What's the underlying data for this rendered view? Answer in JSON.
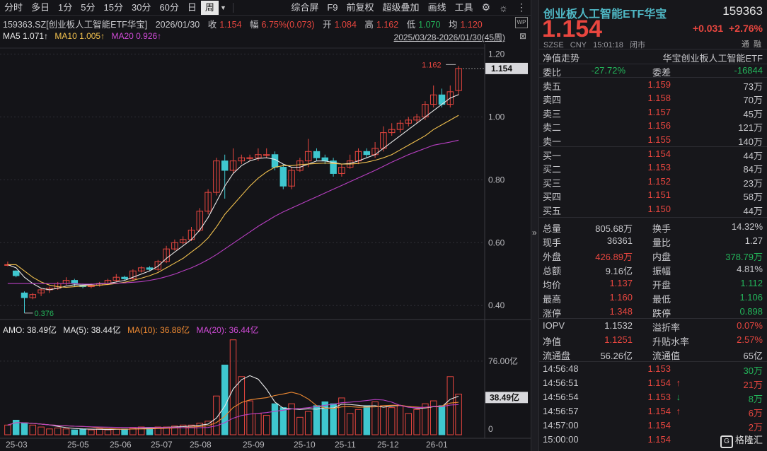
{
  "toolbar": {
    "periods": [
      "分时",
      "多日",
      "1分",
      "5分",
      "15分",
      "30分",
      "60分",
      "日",
      "周"
    ],
    "active_index": 8,
    "dropdown_icon": "caret-down-icon",
    "tools": [
      "综合屏",
      "F9",
      "前复权",
      "超级叠加",
      "画线",
      "工具"
    ],
    "icons": [
      "gear-icon",
      "sun-icon",
      "more-icon"
    ]
  },
  "info": {
    "symbol": "159363.SZ[创业板人工智能ETF华宝]",
    "date": "2026/01/30",
    "close_label": "收",
    "close": "1.154",
    "amp_label": "幅",
    "amp": "6.75%(0.073)",
    "open_label": "开",
    "open": "1.084",
    "high_label": "高",
    "high": "1.162",
    "low_label": "低",
    "low": "1.070",
    "avg_label": "均",
    "avg": "1.120"
  },
  "ma": {
    "ma5": "MA5 1.071↑",
    "ma10": "MA10 1.005↑",
    "ma20": "MA20 0.926↑"
  },
  "range_text": "2025/03/28-2026/01/30(45周)",
  "amo": {
    "label": "AMO: 38.49亿",
    "ma5": "MA(5): 38.44亿",
    "ma10": "MA(10): 36.88亿",
    "ma20": "MA(20): 36.44亿"
  },
  "chart_data": {
    "type": "candlestick",
    "y_ticks": [
      "1.20",
      "1.00",
      "0.80",
      "0.60",
      "0.40"
    ],
    "ylim": [
      0.36,
      1.21
    ],
    "x_ticks": [
      "25-03",
      "25-05",
      "25-06",
      "25-07",
      "25-08",
      "25-09",
      "25-10",
      "25-11",
      "25-12",
      "26-01"
    ],
    "price_tag": "1.154",
    "high_marker": "1.162",
    "low_marker": "0.376",
    "candles": [
      [
        0.53,
        0.53,
        0.54,
        0.525
      ],
      [
        0.51,
        0.495,
        0.512,
        0.49
      ],
      [
        0.44,
        0.425,
        0.445,
        0.376
      ],
      [
        0.425,
        0.435,
        0.44,
        0.42
      ],
      [
        0.44,
        0.45,
        0.455,
        0.43
      ],
      [
        0.45,
        0.455,
        0.46,
        0.44
      ],
      [
        0.455,
        0.47,
        0.475,
        0.45
      ],
      [
        0.47,
        0.48,
        0.49,
        0.465
      ],
      [
        0.48,
        0.47,
        0.485,
        0.46
      ],
      [
        0.465,
        0.46,
        0.47,
        0.455
      ],
      [
        0.46,
        0.465,
        0.47,
        0.455
      ],
      [
        0.465,
        0.47,
        0.475,
        0.46
      ],
      [
        0.47,
        0.48,
        0.485,
        0.465
      ],
      [
        0.48,
        0.49,
        0.5,
        0.475
      ],
      [
        0.49,
        0.485,
        0.495,
        0.48
      ],
      [
        0.485,
        0.51,
        0.515,
        0.48
      ],
      [
        0.51,
        0.52,
        0.525,
        0.505
      ],
      [
        0.52,
        0.515,
        0.525,
        0.51
      ],
      [
        0.515,
        0.54,
        0.545,
        0.51
      ],
      [
        0.54,
        0.58,
        0.59,
        0.535
      ],
      [
        0.58,
        0.6,
        0.61,
        0.575
      ],
      [
        0.6,
        0.61,
        0.62,
        0.595
      ],
      [
        0.61,
        0.64,
        0.65,
        0.605
      ],
      [
        0.64,
        0.7,
        0.71,
        0.635
      ],
      [
        0.7,
        0.76,
        0.77,
        0.69
      ],
      [
        0.76,
        0.86,
        0.87,
        0.75
      ],
      [
        0.86,
        0.83,
        0.88,
        0.74
      ],
      [
        0.83,
        0.86,
        0.9,
        0.82
      ],
      [
        0.86,
        0.87,
        0.88,
        0.85
      ],
      [
        0.87,
        0.87,
        0.88,
        0.86
      ],
      [
        0.87,
        0.88,
        0.9,
        0.86
      ],
      [
        0.88,
        0.88,
        0.9,
        0.87
      ],
      [
        0.88,
        0.84,
        0.89,
        0.83
      ],
      [
        0.84,
        0.78,
        0.85,
        0.77
      ],
      [
        0.78,
        0.83,
        0.84,
        0.77
      ],
      [
        0.83,
        0.86,
        0.87,
        0.825
      ],
      [
        0.86,
        0.89,
        0.93,
        0.84
      ],
      [
        0.89,
        0.87,
        0.9,
        0.86
      ],
      [
        0.87,
        0.86,
        0.88,
        0.85
      ],
      [
        0.86,
        0.82,
        0.87,
        0.81
      ],
      [
        0.82,
        0.84,
        0.85,
        0.81
      ],
      [
        0.84,
        0.86,
        0.88,
        0.835
      ],
      [
        0.86,
        0.89,
        0.9,
        0.85
      ],
      [
        0.89,
        0.88,
        0.9,
        0.87
      ],
      [
        0.88,
        0.9,
        0.92,
        0.87
      ],
      [
        0.9,
        0.95,
        0.97,
        0.89
      ],
      [
        0.95,
        0.96,
        0.98,
        0.94
      ],
      [
        0.96,
        0.98,
        0.99,
        0.95
      ],
      [
        0.98,
        0.99,
        1.0,
        0.97
      ],
      [
        0.99,
        1.0,
        1.01,
        0.98
      ],
      [
        1.0,
        1.04,
        1.05,
        0.99
      ],
      [
        1.04,
        1.07,
        1.1,
        1.03
      ],
      [
        1.07,
        1.04,
        1.09,
        1.03
      ],
      [
        1.04,
        1.08,
        1.1,
        1.03
      ],
      [
        1.084,
        1.154,
        1.162,
        1.07
      ]
    ],
    "ma5": [
      0.53,
      0.52,
      0.49,
      0.47,
      0.455,
      0.45,
      0.455,
      0.462,
      0.466,
      0.465,
      0.467,
      0.47,
      0.47,
      0.475,
      0.48,
      0.49,
      0.5,
      0.51,
      0.525,
      0.55,
      0.57,
      0.59,
      0.61,
      0.64,
      0.68,
      0.73,
      0.78,
      0.82,
      0.845,
      0.86,
      0.868,
      0.87,
      0.865,
      0.85,
      0.84,
      0.84,
      0.85,
      0.86,
      0.86,
      0.855,
      0.85,
      0.852,
      0.86,
      0.87,
      0.88,
      0.9,
      0.92,
      0.94,
      0.96,
      0.98,
      1.0,
      1.02,
      1.04,
      1.06,
      1.071
    ],
    "ma10": [
      0.53,
      0.53,
      0.51,
      0.49,
      0.475,
      0.465,
      0.46,
      0.458,
      0.46,
      0.462,
      0.463,
      0.465,
      0.467,
      0.47,
      0.474,
      0.48,
      0.487,
      0.495,
      0.505,
      0.52,
      0.535,
      0.55,
      0.57,
      0.59,
      0.615,
      0.65,
      0.69,
      0.72,
      0.75,
      0.78,
      0.805,
      0.825,
      0.84,
      0.845,
      0.845,
      0.848,
      0.85,
      0.852,
      0.853,
      0.852,
      0.85,
      0.85,
      0.852,
      0.856,
      0.862,
      0.87,
      0.88,
      0.895,
      0.91,
      0.925,
      0.94,
      0.96,
      0.975,
      0.99,
      1.005
    ],
    "ma20": [
      0.47,
      0.47,
      0.47,
      0.47,
      0.47,
      0.47,
      0.47,
      0.47,
      0.47,
      0.468,
      0.468,
      0.469,
      0.47,
      0.471,
      0.472,
      0.474,
      0.476,
      0.48,
      0.485,
      0.492,
      0.5,
      0.51,
      0.52,
      0.532,
      0.546,
      0.562,
      0.58,
      0.598,
      0.616,
      0.634,
      0.652,
      0.668,
      0.684,
      0.698,
      0.71,
      0.722,
      0.734,
      0.746,
      0.758,
      0.77,
      0.782,
      0.794,
      0.806,
      0.818,
      0.83,
      0.843,
      0.856,
      0.868,
      0.88,
      0.89,
      0.9,
      0.91,
      0.915,
      0.92,
      0.926
    ],
    "vol_axis": [
      "76.00亿",
      "0"
    ],
    "vol_tag": "38.49亿",
    "volume": [
      10,
      15,
      12,
      10,
      8,
      6,
      7,
      6,
      5,
      6,
      5,
      6,
      5,
      6,
      6,
      7,
      8,
      7,
      8,
      8,
      9,
      10,
      10,
      12,
      14,
      40,
      72,
      98,
      60,
      35,
      22,
      20,
      32,
      28,
      32,
      18,
      24,
      30,
      34,
      32,
      38,
      22,
      26,
      30,
      34,
      30,
      28,
      30,
      22,
      26,
      32,
      35,
      30,
      60,
      42,
      38.49
    ]
  },
  "right": {
    "title": "创业板人工智能ETF华宝",
    "code": "159363",
    "price": "1.154",
    "change": "+0.031",
    "change_pct": "+2.76%",
    "meta": [
      "SZSE",
      "CNY",
      "15:01:18",
      "闭市"
    ],
    "nav_label": "净值走势",
    "nav_name": "华宝创业板人工智能ETF",
    "ratio_label": "委比",
    "ratio": "-27.72%",
    "diff_label": "委差",
    "diff": "-16844",
    "asks": [
      [
        "卖五",
        "1.159",
        "73万"
      ],
      [
        "卖四",
        "1.158",
        "70万"
      ],
      [
        "卖三",
        "1.157",
        "45万"
      ],
      [
        "卖二",
        "1.156",
        "121万"
      ],
      [
        "卖一",
        "1.155",
        "140万"
      ]
    ],
    "bids": [
      [
        "买一",
        "1.154",
        "44万"
      ],
      [
        "买二",
        "1.153",
        "84万"
      ],
      [
        "买三",
        "1.152",
        "23万"
      ],
      [
        "买四",
        "1.151",
        "58万"
      ],
      [
        "买五",
        "1.150",
        "44万"
      ]
    ],
    "tong": "通",
    "rong": "融",
    "stats": [
      [
        "总量",
        "805.68万",
        "换手",
        "14.32%",
        "n",
        "n"
      ],
      [
        "现手",
        "36361",
        "量比",
        "1.27",
        "n",
        "n"
      ],
      [
        "外盘",
        "426.89万",
        "内盘",
        "378.79万",
        "up",
        "dn"
      ],
      [
        "总额",
        "9.16亿",
        "振幅",
        "4.81%",
        "n",
        "n"
      ],
      [
        "均价",
        "1.137",
        "开盘",
        "1.112",
        "up",
        "dn"
      ],
      [
        "最高",
        "1.160",
        "最低",
        "1.106",
        "up",
        "dn"
      ],
      [
        "涨停",
        "1.348",
        "跌停",
        "0.898",
        "up",
        "dn"
      ]
    ],
    "iopv": [
      [
        "IOPV",
        "1.1532",
        "溢折率",
        "0.07%"
      ],
      [
        "净值",
        "1.1251",
        "升贴水率",
        "2.57%"
      ],
      [
        "流通盘",
        "56.26亿",
        "流通值",
        "65亿"
      ]
    ],
    "ticks": [
      [
        "14:56:48",
        "1.153",
        "",
        "30万"
      ],
      [
        "14:56:51",
        "1.154",
        "↑",
        "21万"
      ],
      [
        "14:56:54",
        "1.153",
        "↓",
        "8万"
      ],
      [
        "14:56:57",
        "1.154",
        "↑",
        "6万"
      ],
      [
        "14:57:00",
        "1.154",
        "",
        "2万"
      ],
      [
        "15:00:00",
        "1.154",
        "",
        ""
      ]
    ],
    "watermark": "格隆汇"
  }
}
